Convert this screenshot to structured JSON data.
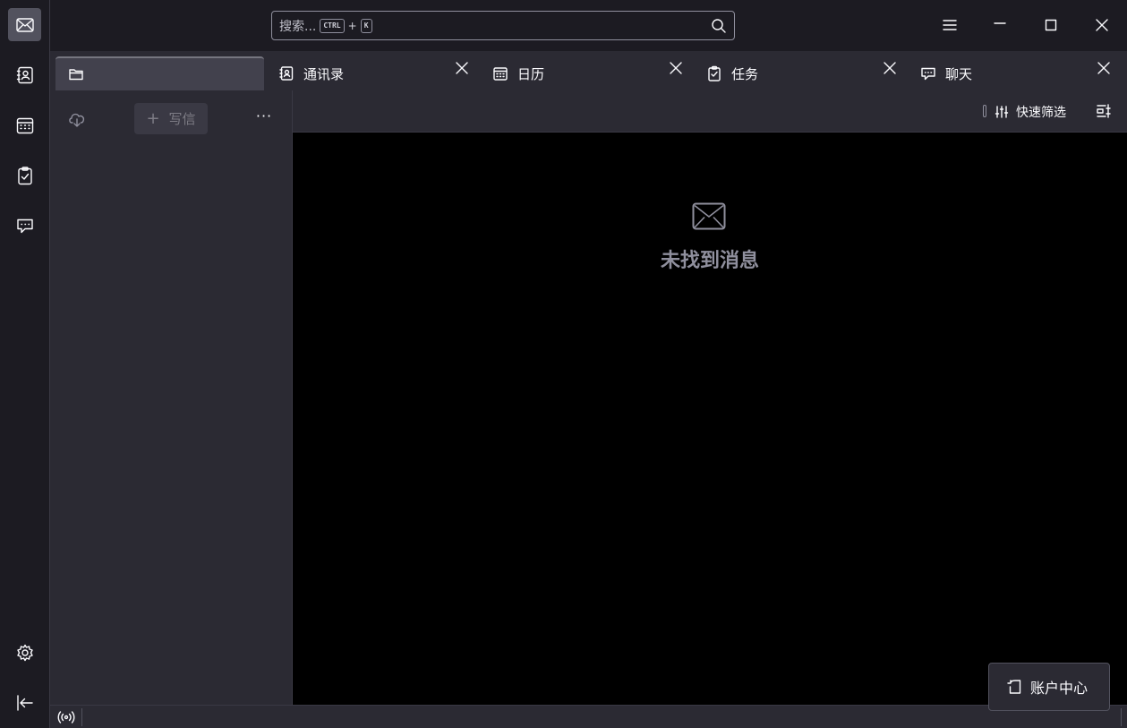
{
  "search": {
    "placeholder": "搜索...",
    "shortcut_ctrl": "CTRL",
    "shortcut_plus": "+",
    "shortcut_key": "K"
  },
  "tabs": [
    {
      "label": "",
      "icon": "folder-icon",
      "active": true
    },
    {
      "label": "通讯录",
      "icon": "address-book-icon"
    },
    {
      "label": "日历",
      "icon": "calendar-icon"
    },
    {
      "label": "任务",
      "icon": "tasks-icon"
    },
    {
      "label": "聊天",
      "icon": "chat-icon"
    }
  ],
  "spaces": [
    {
      "name": "mail",
      "icon": "mail-icon",
      "active": true
    },
    {
      "name": "address-book",
      "icon": "address-book-icon"
    },
    {
      "name": "calendar",
      "icon": "calendar-icon"
    },
    {
      "name": "tasks",
      "icon": "tasks-icon"
    },
    {
      "name": "chat",
      "icon": "chat-icon"
    },
    {
      "name": "settings",
      "icon": "gear-icon"
    },
    {
      "name": "collapse",
      "icon": "collapse-left-icon"
    }
  ],
  "folder_pane": {
    "compose_label": "写信",
    "compose_plus": "+",
    "more": "···"
  },
  "thread_header": {
    "quick_filter_label": "快速筛选"
  },
  "thread_pane": {
    "empty_message": "未找到消息"
  },
  "account_hub": {
    "label": "账户中心"
  },
  "colors": {
    "background": "#1c1b22",
    "panel": "#2b2a33",
    "thread_bg": "#000000",
    "text": "#fbfbfe",
    "muted": "#8f8f9d"
  }
}
